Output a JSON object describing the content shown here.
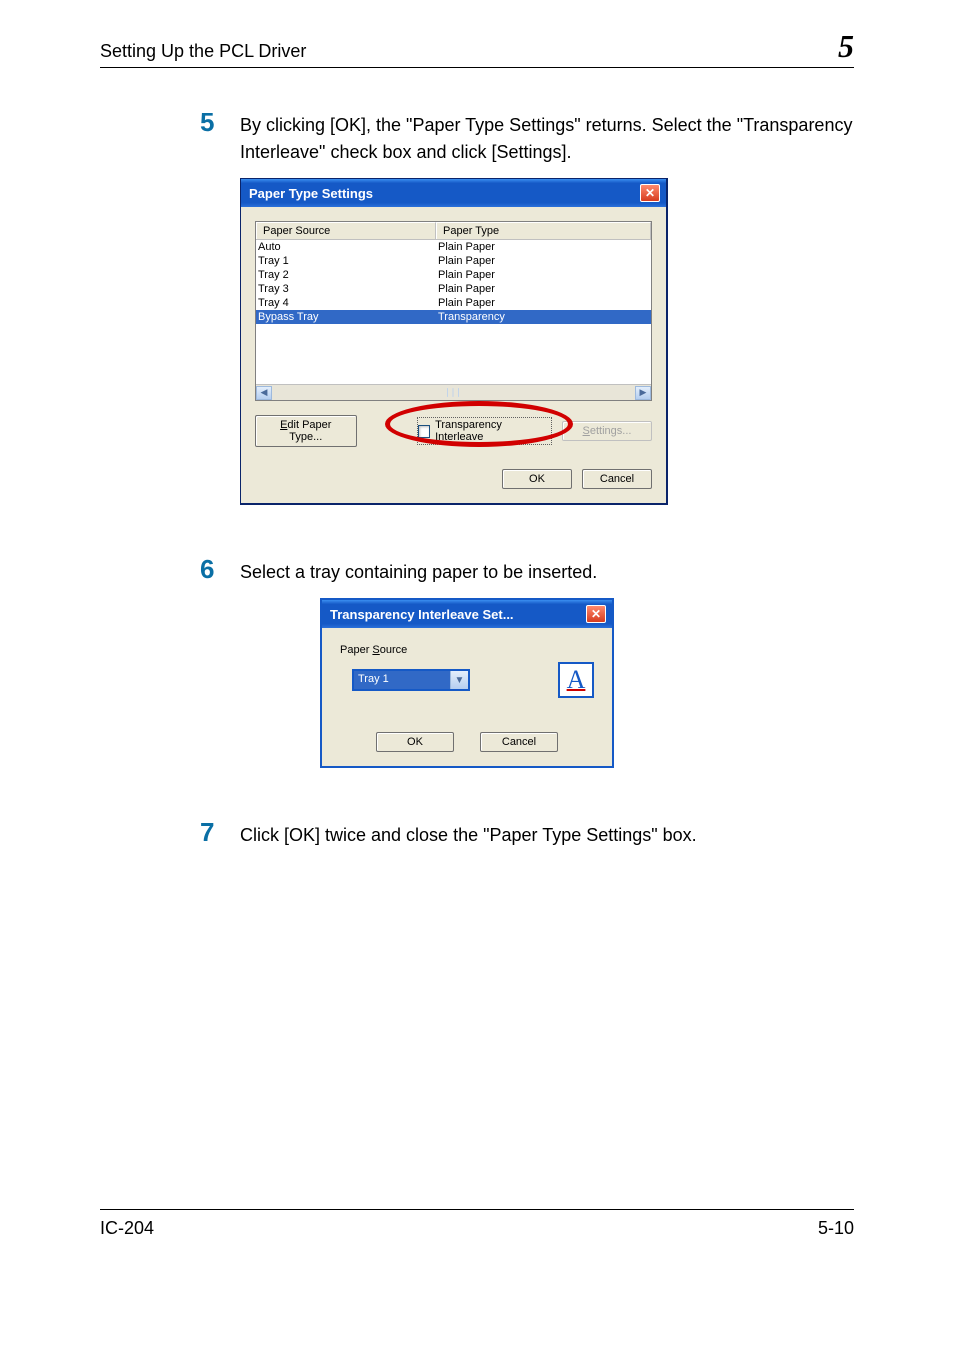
{
  "header": {
    "title": "Setting Up the PCL Driver",
    "chapter": "5"
  },
  "steps": {
    "s5": {
      "num": "5",
      "text": "By clicking [OK], the \"Paper Type Settings\" returns. Select the \"Transparency Interleave\" check box and click [Settings]."
    },
    "s6": {
      "num": "6",
      "text": "Select a tray containing paper to be inserted."
    },
    "s7": {
      "num": "7",
      "text": "Click [OK] twice and close the \"Paper Type Settings\" box."
    }
  },
  "dialog1": {
    "title": "Paper Type Settings",
    "columns": {
      "c1": "Paper Source",
      "c2": "Paper Type"
    },
    "rows": [
      {
        "source": "Auto",
        "type": "Plain Paper",
        "selected": false
      },
      {
        "source": "Tray 1",
        "type": "Plain Paper",
        "selected": false
      },
      {
        "source": "Tray 2",
        "type": "Plain Paper",
        "selected": false
      },
      {
        "source": "Tray 3",
        "type": "Plain Paper",
        "selected": false
      },
      {
        "source": "Tray 4",
        "type": "Plain Paper",
        "selected": false
      },
      {
        "source": "Bypass Tray",
        "type": "Transparency",
        "selected": true
      }
    ],
    "editButton": "Edit Paper Type...",
    "checkboxLabel": "Transparency Interleave",
    "settingsButton": "Settings...",
    "ok": "OK",
    "cancel": "Cancel"
  },
  "dialog2": {
    "title": "Transparency Interleave Set...",
    "paperSourceLabel": "Paper Source",
    "paperSourceValue": "Tray 1",
    "iconLetter": "A",
    "ok": "OK",
    "cancel": "Cancel"
  },
  "footer": {
    "left": "IC-204",
    "right": "5-10"
  }
}
